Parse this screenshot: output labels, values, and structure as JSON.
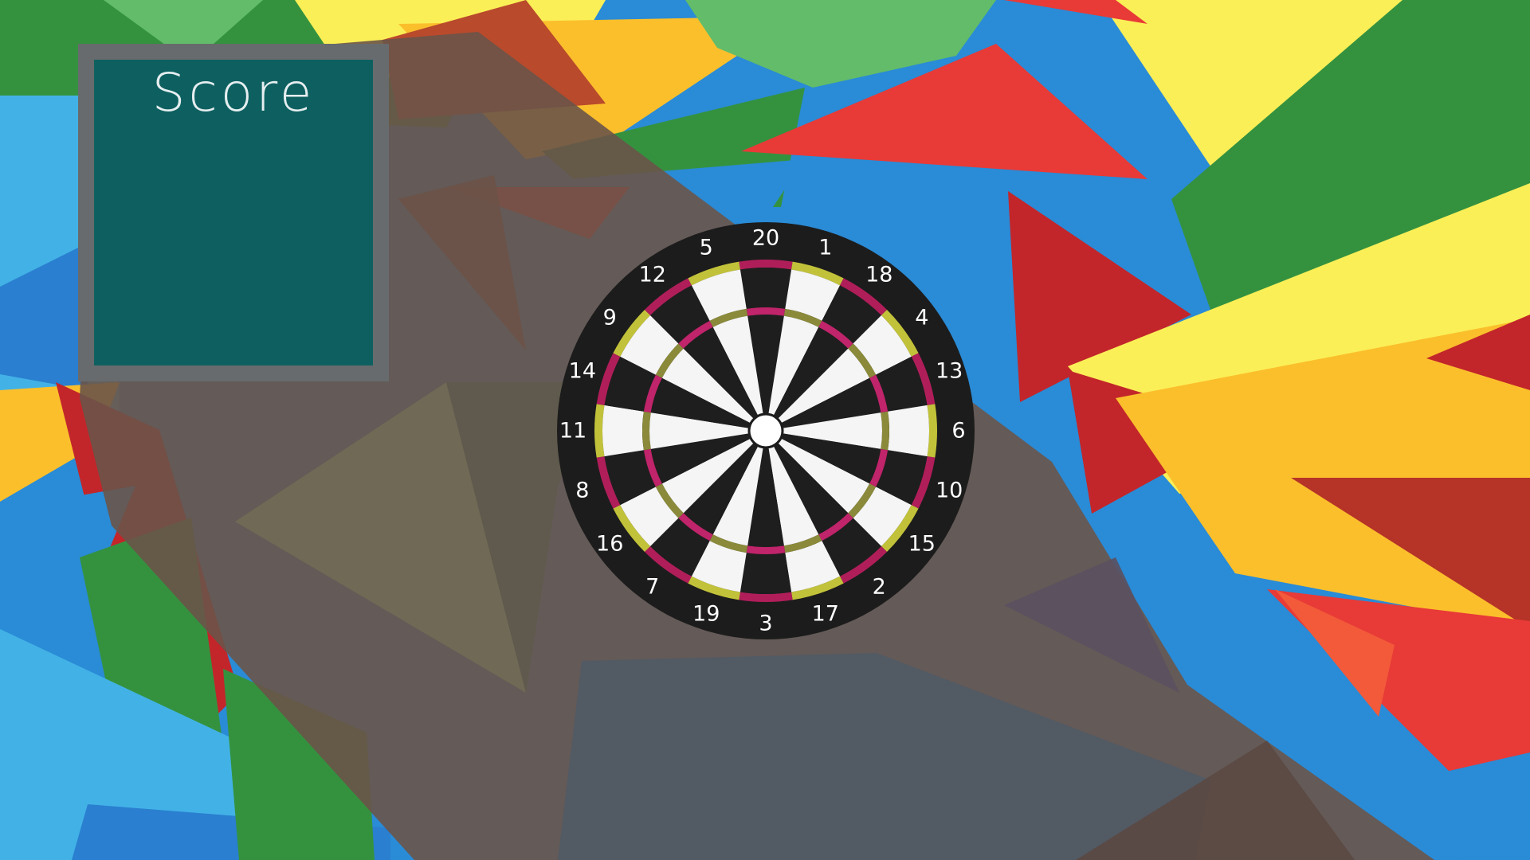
{
  "score_panel": {
    "title": "Score"
  },
  "dartboard": {
    "numbers": [
      "20",
      "1",
      "18",
      "4",
      "13",
      "6",
      "10",
      "15",
      "2",
      "17",
      "3",
      "19",
      "7",
      "16",
      "8",
      "11",
      "14",
      "9",
      "12",
      "5"
    ],
    "colors": {
      "board": "#1c1c1c",
      "black_segment": "#1e1e1e",
      "white_segment": "#f5f5f5",
      "ring_a": "#c2c23a",
      "ring_b": "#b01e5a",
      "ring_a_inner": "#8a8a3a",
      "ring_b_inner": "#c0246a",
      "bull": "#ffffff",
      "number": "#ffffff"
    }
  },
  "background_colors": {
    "blue": "#2a8bd6",
    "light_blue": "#42b2e6",
    "green": "#34923f",
    "light_green": "#62bc69",
    "yellow": "#fbef57",
    "orange": "#fbbf2c",
    "red": "#e83a37",
    "dark_red": "#c2262a",
    "brown_overlay": "#6a5449"
  }
}
